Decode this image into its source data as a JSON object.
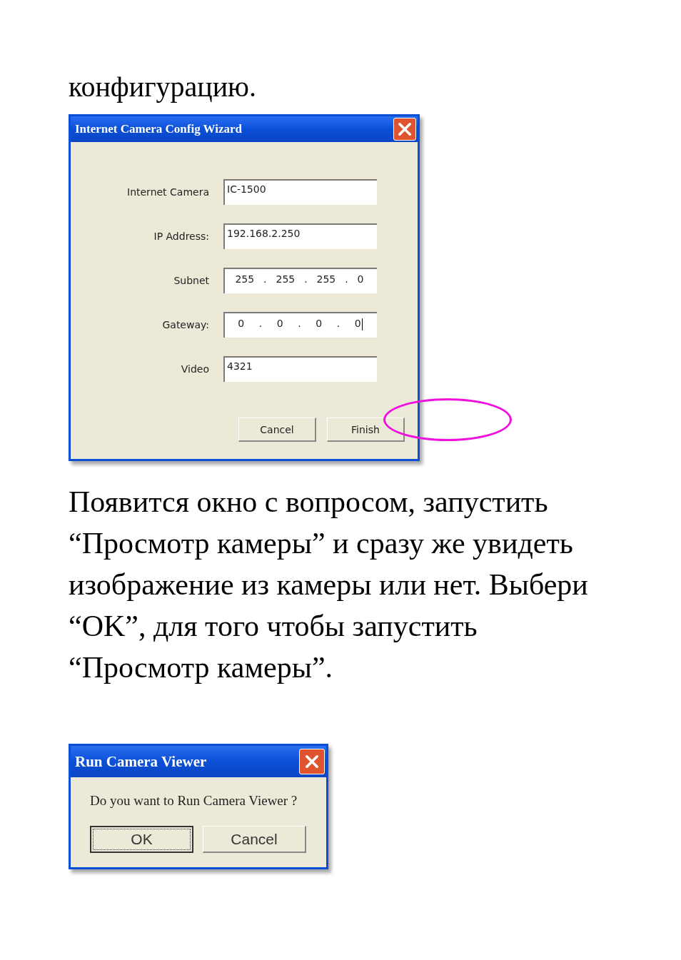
{
  "lead_text": "конфигурацию.",
  "config_dialog": {
    "title": "Internet Camera Config Wizard",
    "fields": [
      {
        "label": "Internet Camera",
        "kind": "text",
        "value": "IC-1500"
      },
      {
        "label": "IP Address:",
        "kind": "text",
        "value": "192.168.2.250"
      },
      {
        "label": "Subnet",
        "kind": "ip",
        "segments": [
          "255",
          "255",
          "255",
          "0"
        ],
        "separators": [
          ".",
          ".",
          "."
        ]
      },
      {
        "label": "Gateway:",
        "kind": "ip",
        "segments": [
          "0",
          "0",
          "0",
          "0"
        ],
        "separators": [
          ".",
          ".",
          "."
        ],
        "focused": true
      },
      {
        "label": "Video",
        "kind": "text",
        "value": "4321"
      }
    ],
    "buttons": [
      {
        "label": "Cancel",
        "default": false,
        "highlighted": false
      },
      {
        "label": "Finish",
        "default": false,
        "highlighted": true
      }
    ]
  },
  "paragraph": "Появится окно с вопросом, запустить “Просмотр камеры” и сразу же увидеть изображение из камеры или нет. Выбери “OK”, для того чтобы запустить “Просмотр камеры”.",
  "viewer_dialog": {
    "title": "Run Camera Viewer",
    "message": "Do you want to Run Camera Viewer ?",
    "buttons": [
      {
        "label": "OK",
        "default": true
      },
      {
        "label": "Cancel",
        "default": false
      }
    ]
  }
}
